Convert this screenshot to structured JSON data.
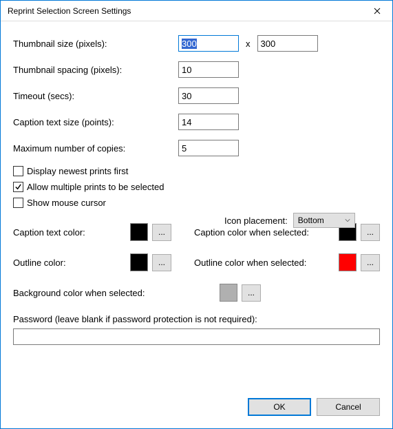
{
  "title": "Reprint Selection Screen Settings",
  "fields": {
    "thumb_size_label": "Thumbnail size (pixels):",
    "thumb_w": "300",
    "x": "x",
    "thumb_h": "300",
    "spacing_label": "Thumbnail spacing (pixels):",
    "spacing": "10",
    "timeout_label": "Timeout (secs):",
    "timeout": "30",
    "caption_size_label": "Caption text size (points):",
    "caption_size": "14",
    "max_copies_label": "Maximum number of copies:",
    "max_copies": "5"
  },
  "checks": {
    "newest_first": {
      "label": "Display newest prints first",
      "checked": false
    },
    "allow_multiple": {
      "label": "Allow multiple prints to be selected",
      "checked": true
    },
    "show_cursor": {
      "label": "Show mouse cursor",
      "checked": false
    }
  },
  "icon_placement": {
    "label": "Icon placement:",
    "value": "Bottom"
  },
  "colors": {
    "caption_text": {
      "label": "Caption text color:",
      "value": "#000000"
    },
    "caption_selected": {
      "label": "Caption color when selected:",
      "value": "#000000"
    },
    "outline": {
      "label": "Outline color:",
      "value": "#000000"
    },
    "outline_selected": {
      "label": "Outline color when selected:",
      "value": "#ff0000"
    },
    "bg_selected": {
      "label": "Background color when selected:",
      "value": "#b0b0b0"
    },
    "pick": "..."
  },
  "password": {
    "label": "Password (leave blank if password protection is not required):",
    "value": ""
  },
  "buttons": {
    "ok": "OK",
    "cancel": "Cancel"
  }
}
